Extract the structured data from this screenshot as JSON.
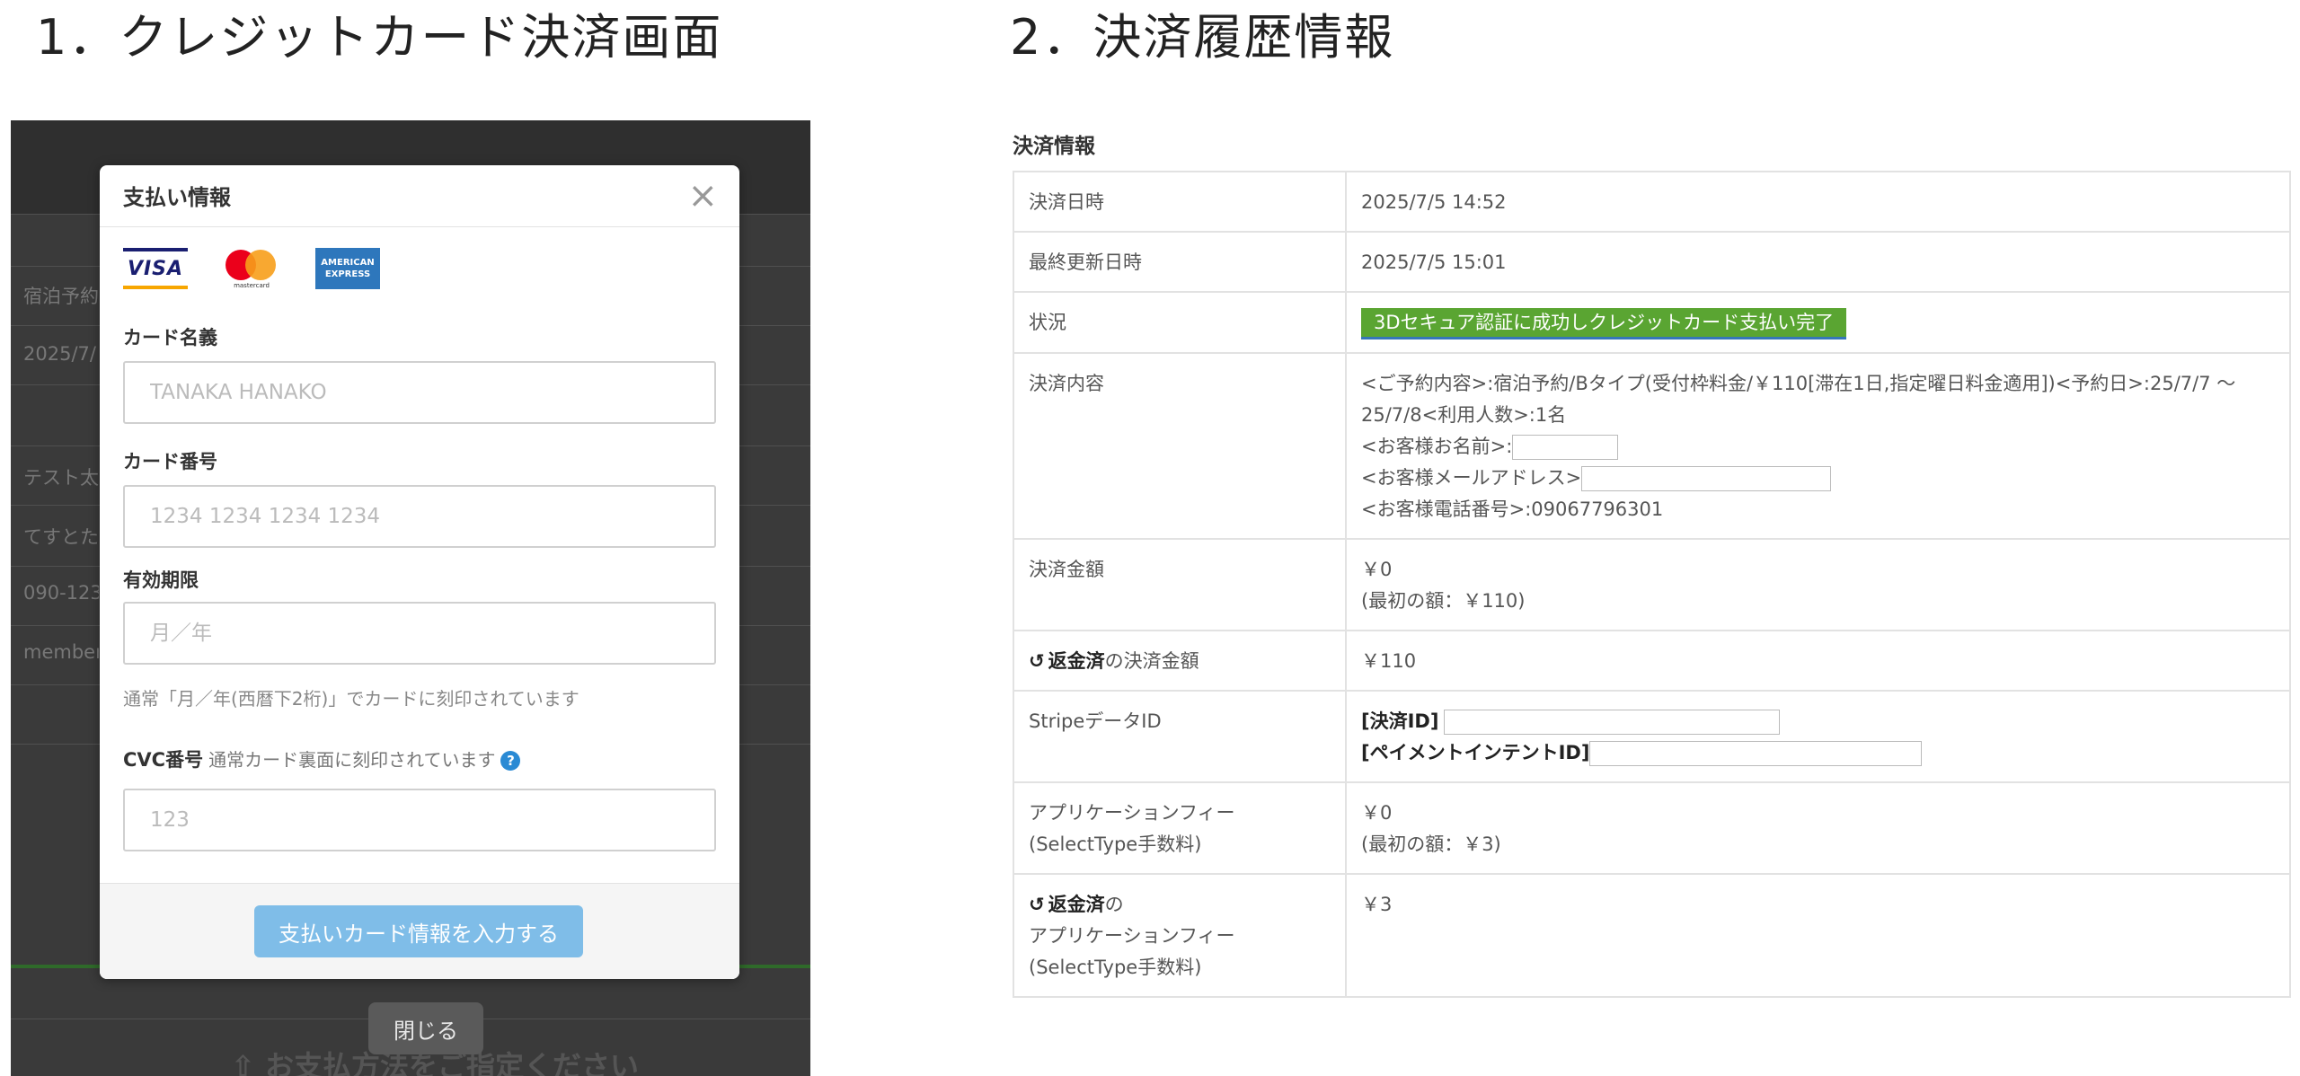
{
  "headings": {
    "left": "1．クレジットカード決済画面",
    "right": "2．決済履歴情報"
  },
  "background": {
    "rows": [
      "宿泊予約",
      "2025/7/",
      "テスト太",
      "てすとた",
      "090-123",
      "member"
    ],
    "bottom_text": "⇧ お支払方法をご指定ください",
    "close_label": "閉じる"
  },
  "modal": {
    "title": "支払い情報",
    "close_glyph": "×",
    "card_brands": {
      "visa": "VISA",
      "mastercard_caption": "mastercard",
      "amex_line1": "AMERICAN",
      "amex_line2": "EXPRESS"
    },
    "fields": {
      "name": {
        "label": "カード名義",
        "placeholder": "TANAKA HANAKO"
      },
      "number": {
        "label": "カード番号",
        "placeholder": "1234 1234 1234 1234"
      },
      "expiry": {
        "label": "有効期限",
        "placeholder": "月／年",
        "hint": "通常「月／年(西暦下2桁)」でカードに刻印されています"
      },
      "cvc": {
        "label": "CVC番号",
        "sub": "通常カード裏面に刻印されています",
        "help_glyph": "?",
        "placeholder": "123"
      }
    },
    "submit_label": "支払いカード情報を入力する"
  },
  "payment_info": {
    "section_title": "決済情報",
    "rows": {
      "datetime": {
        "label": "決済日時",
        "value": "2025/7/5 14:52"
      },
      "updated": {
        "label": "最終更新日時",
        "value": "2025/7/5 15:01"
      },
      "status": {
        "label": "状況",
        "value": "3Dセキュア認証に成功しクレジットカード支払い完了"
      },
      "content": {
        "label": "決済内容",
        "line1": "<ご予約内容>:宿泊予約/Bタイプ(受付枠料金/￥110[滞在1日,指定曜日料金適用])<予約日>:25/7/7 ～ 25/7/8<利用人数>:1名",
        "line2": "<お客様お名前>:",
        "line3": "<お客様メールアドレス>",
        "line4": "<お客様電話番号>:09067796301"
      },
      "amount": {
        "label": "決済金額",
        "value": "￥0",
        "original": "(最初の額：￥110)"
      },
      "refunded_amount": {
        "icon": "↺",
        "label_bold": "返金済",
        "label_rest": "の決済金額",
        "value": "￥110"
      },
      "stripe": {
        "label": "StripeデータID",
        "payment_id_label": "[決済ID]",
        "intent_id_label": "[ペイメントインテントID]"
      },
      "app_fee": {
        "label_line1": "アプリケーションフィー",
        "label_line2": "(SelectType手数料)",
        "value": "￥0",
        "original": "(最初の額：￥3)"
      },
      "refunded_fee": {
        "icon": "↺",
        "label_bold": "返金済",
        "label_rest": "の",
        "label_line2": "アプリケーションフィー",
        "label_line3": "(SelectType手数料)",
        "value": "￥3"
      }
    }
  },
  "colors": {
    "modal_button": "#7fbde8",
    "status_badge": "#5aa532",
    "overlay": "#3a3a3a"
  }
}
